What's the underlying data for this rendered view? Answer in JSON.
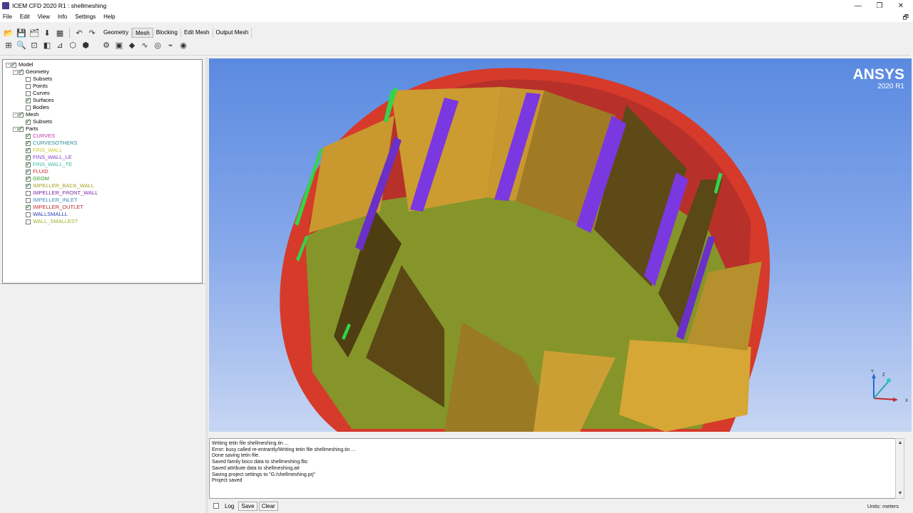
{
  "window": {
    "title": "ICEM CFD 2020 R1 : shellmeshing",
    "minimize": "—",
    "restore": "❐",
    "close": "✕"
  },
  "menu": {
    "items": [
      "File",
      "Edit",
      "View",
      "Info",
      "Settings",
      "Help"
    ],
    "restore_icon": "🗗"
  },
  "tabs": [
    {
      "label": "Geometry",
      "active": false
    },
    {
      "label": "Mesh",
      "active": true
    },
    {
      "label": "Blocking",
      "active": false
    },
    {
      "label": "Edit Mesh",
      "active": false
    },
    {
      "label": "Output Mesh",
      "active": false
    }
  ],
  "toolbar": {
    "row1_icons": [
      "open-folder-icon",
      "save-icon",
      "save-project-icon",
      "import-geometry-icon",
      "import-mesh-icon",
      "undo-icon",
      "redo-icon"
    ],
    "row2_icons": [
      "fit-window-icon",
      "zoom-icon",
      "zoom-box-icon",
      "view-toggle-icon",
      "measure-icon",
      "wireframe-icon",
      "solid-icon"
    ],
    "mesh_icons": [
      "global-mesh-setup-icon",
      "part-mesh-setup-icon",
      "surface-mesh-setup-icon",
      "curve-mesh-setup-icon",
      "create-mesh-density-icon",
      "connectors-icon",
      "compute-mesh-icon"
    ]
  },
  "tree": {
    "items": [
      {
        "label": "Model",
        "indent": 0,
        "expander": "-",
        "checked": true,
        "color": "#000000"
      },
      {
        "label": "Geometry",
        "indent": 1,
        "expander": "-",
        "checked": true,
        "color": "#000000"
      },
      {
        "label": "Subsets",
        "indent": 2,
        "expander": "",
        "checked": false,
        "color": "#000000"
      },
      {
        "label": "Points",
        "indent": 2,
        "expander": "",
        "checked": false,
        "color": "#000000"
      },
      {
        "label": "Curves",
        "indent": 2,
        "expander": "",
        "checked": false,
        "color": "#000000"
      },
      {
        "label": "Surfaces",
        "indent": 2,
        "expander": "",
        "checked": true,
        "color": "#000000"
      },
      {
        "label": "Bodies",
        "indent": 2,
        "expander": "",
        "checked": false,
        "color": "#000000"
      },
      {
        "label": "Mesh",
        "indent": 1,
        "expander": "-",
        "checked": true,
        "color": "#000000"
      },
      {
        "label": "Subsets",
        "indent": 2,
        "expander": "",
        "checked": true,
        "color": "#000000"
      },
      {
        "label": "Parts",
        "indent": 1,
        "expander": "-",
        "checked": true,
        "color": "#000000"
      },
      {
        "label": "CURVES",
        "indent": 2,
        "expander": "",
        "checked": true,
        "color": "#c03aa8"
      },
      {
        "label": "CURVESOTHERS",
        "indent": 2,
        "expander": "",
        "checked": true,
        "color": "#2a8a9a"
      },
      {
        "label": "FINS_WALL",
        "indent": 2,
        "expander": "",
        "checked": true,
        "color": "#c8c82a"
      },
      {
        "label": "FINS_WALL_LE",
        "indent": 2,
        "expander": "",
        "checked": true,
        "color": "#8a3ac8"
      },
      {
        "label": "FINS_WALL_TE",
        "indent": 2,
        "expander": "",
        "checked": true,
        "color": "#3ab8a0"
      },
      {
        "label": "FLUID",
        "indent": 2,
        "expander": "",
        "checked": true,
        "color": "#d02a2a"
      },
      {
        "label": "GEOM",
        "indent": 2,
        "expander": "",
        "checked": true,
        "color": "#2a9a2a"
      },
      {
        "label": "IMPELLER_BACK_WALL",
        "indent": 2,
        "expander": "",
        "checked": true,
        "color": "#a8a020"
      },
      {
        "label": "IMPELLER_FRONT_WALL",
        "indent": 2,
        "expander": "",
        "checked": false,
        "color": "#7a2aa8"
      },
      {
        "label": "IMPELLER_INLET",
        "indent": 2,
        "expander": "",
        "checked": false,
        "color": "#3a8ab8"
      },
      {
        "label": "IMPELLER_OUTLET",
        "indent": 2,
        "expander": "",
        "checked": true,
        "color": "#c02a2a"
      },
      {
        "label": "WALLSMALLL",
        "indent": 2,
        "expander": "",
        "checked": false,
        "color": "#2a3ab0"
      },
      {
        "label": "WALL_SMALLEST",
        "indent": 2,
        "expander": "",
        "checked": false,
        "color": "#a0b02a"
      }
    ]
  },
  "viewport": {
    "brand_name": "ANSYS",
    "brand_version": "2020 R1",
    "axis_labels": {
      "y": "Y",
      "z": "Z",
      "x": "X"
    },
    "colors": {
      "shroud": "#e0402e",
      "hub": "#86962a",
      "fin_face": "#cfa033",
      "fin_shadow": "#6b5418",
      "fin_edge": "#7a3ae0",
      "fin_tip": "#3adf4a"
    }
  },
  "log": {
    "lines": [
      "Writing tetin file shellmeshing.tin ...",
      "Error: busy called re-entrantly/Writing tetin file shellmeshing.tin ...",
      "Done saving tetin file.",
      "Saved family boco data to shellmeshing.fbc",
      "Saved attribute data to shellmeshing.atr",
      "Saving project settings to \"G:/shellmeshing.prj\"",
      "Project saved"
    ]
  },
  "bottom": {
    "log_label": "Log",
    "save_label": "Save",
    "clear_label": "Clear",
    "units": "Units: meters"
  }
}
